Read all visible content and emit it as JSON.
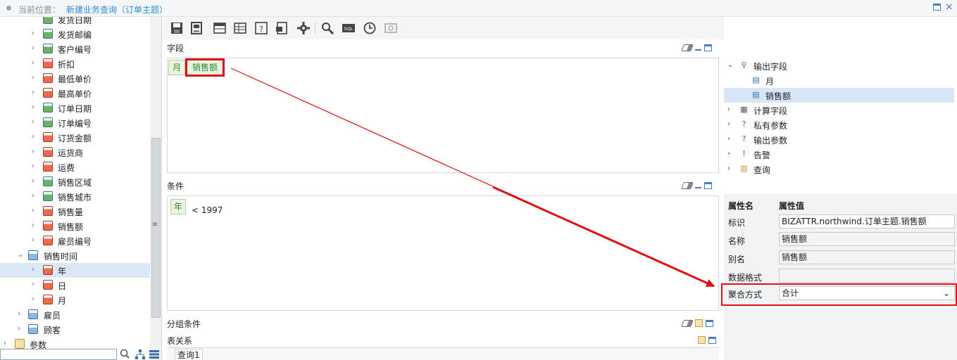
{
  "location": {
    "label": "当前位置：",
    "value": "新建业务查询（订单主题）"
  },
  "left_tree": {
    "items": [
      {
        "label": "发货日期",
        "icon": "blue",
        "level": 2,
        "chevron": ""
      },
      {
        "label": "发货邮编",
        "icon": "blue",
        "level": 2,
        "chevron": "›"
      },
      {
        "label": "客户编号",
        "icon": "blue",
        "level": 2,
        "chevron": "›"
      },
      {
        "label": "折扣",
        "icon": "red",
        "level": 2,
        "chevron": "›"
      },
      {
        "label": "最低单价",
        "icon": "red",
        "level": 2,
        "chevron": "›"
      },
      {
        "label": "最高单价",
        "icon": "red",
        "level": 2,
        "chevron": "›"
      },
      {
        "label": "订单日期",
        "icon": "blue",
        "level": 2,
        "chevron": "›"
      },
      {
        "label": "订单编号",
        "icon": "blue",
        "level": 2,
        "chevron": "›"
      },
      {
        "label": "订货金额",
        "icon": "red",
        "level": 2,
        "chevron": "›"
      },
      {
        "label": "运货商",
        "icon": "red",
        "level": 2,
        "chevron": "›"
      },
      {
        "label": "运费",
        "icon": "red",
        "level": 2,
        "chevron": "›"
      },
      {
        "label": "销售区域",
        "icon": "blue",
        "level": 2,
        "chevron": "›"
      },
      {
        "label": "销售城市",
        "icon": "blue",
        "level": 2,
        "chevron": "›"
      },
      {
        "label": "销售量",
        "icon": "red",
        "level": 2,
        "chevron": "›"
      },
      {
        "label": "销售额",
        "icon": "red",
        "level": 2,
        "chevron": "›"
      },
      {
        "label": "雇员编号",
        "icon": "red",
        "level": 2,
        "chevron": "›"
      },
      {
        "label": "销售时间",
        "icon": "folder",
        "level": 1,
        "chevron": "⌄"
      },
      {
        "label": "年",
        "icon": "red",
        "level": 2,
        "chevron": "›",
        "selected": true
      },
      {
        "label": "日",
        "icon": "red",
        "level": 2,
        "chevron": "›"
      },
      {
        "label": "月",
        "icon": "red",
        "level": 2,
        "chevron": "›"
      },
      {
        "label": "雇员",
        "icon": "folder",
        "level": 1,
        "chevron": "›"
      },
      {
        "label": "顾客",
        "icon": "folder",
        "level": 1,
        "chevron": "›"
      },
      {
        "label": "参数",
        "icon": "param",
        "level": 0,
        "chevron": "›"
      }
    ]
  },
  "toolbar": {
    "icons": [
      "save-icon",
      "save-as-icon",
      "table-icon",
      "grid-icon",
      "help-icon",
      "export-icon",
      "settings-icon",
      "search-icon",
      "sql-icon",
      "clock-icon",
      "preview-icon"
    ],
    "sql_label": "SQL"
  },
  "fields_panel": {
    "title": "字段",
    "chips": [
      "月",
      "销售额"
    ]
  },
  "conditions_panel": {
    "title": "条件",
    "chip": "年",
    "expression": "< 1997"
  },
  "group_panel": {
    "title": "分组条件"
  },
  "relation_panel": {
    "title": "表关系",
    "tab": "查询1"
  },
  "right_tree": {
    "items": [
      {
        "label": "输出字段",
        "icon": "⚲",
        "chevron": "⌄",
        "level": 0
      },
      {
        "label": "月",
        "icon": "▤",
        "chevron": "",
        "level": 1
      },
      {
        "label": "销售额",
        "icon": "▤",
        "chevron": "",
        "level": 1,
        "selected": true
      },
      {
        "label": "计算字段",
        "icon": "▦",
        "chevron": "›",
        "level": 0
      },
      {
        "label": "私有参数",
        "icon": "?",
        "chevron": "›",
        "level": 0
      },
      {
        "label": "输出参数",
        "icon": "?",
        "chevron": "›",
        "level": 0
      },
      {
        "label": "告警",
        "icon": "!",
        "chevron": "›",
        "level": 0
      },
      {
        "label": "查询",
        "icon": "▥",
        "chevron": "›",
        "level": 0
      }
    ]
  },
  "properties": {
    "header_name": "属性名",
    "header_value": "属性值",
    "rows": [
      {
        "name": "标识",
        "value": "BIZATTR.northwind.订单主题.销售额",
        "grey": false
      },
      {
        "name": "名称",
        "value": "销售额",
        "grey": true
      },
      {
        "name": "别名",
        "value": "销售额",
        "grey": true
      },
      {
        "name": "数据格式",
        "value": "",
        "grey": true
      },
      {
        "name": "聚合方式",
        "value": "合计",
        "grey": false,
        "select": true
      }
    ]
  },
  "colors": {
    "accent": "#2f8fd8",
    "highlight": "#e01010",
    "chip_green": "#2e8b2e"
  }
}
